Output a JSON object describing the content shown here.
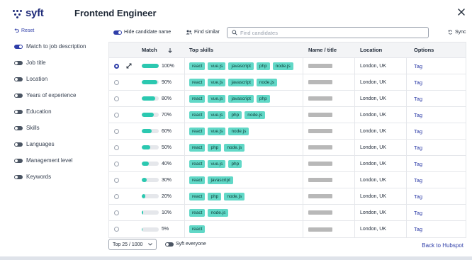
{
  "header": {
    "brand": "syft",
    "title": "Frontend Engineer",
    "close_icon": "close-icon",
    "brand_color": "#1e2a78"
  },
  "sidebar": {
    "reset_label": "Reset",
    "filters": [
      {
        "label": "Match to job description",
        "on": true
      },
      {
        "label": "Job title",
        "on": false
      },
      {
        "label": "Location",
        "on": false
      },
      {
        "label": "Years of experience",
        "on": false
      },
      {
        "label": "Education",
        "on": false
      },
      {
        "label": "Skills",
        "on": false
      },
      {
        "label": "Languages",
        "on": false
      },
      {
        "label": "Management level",
        "on": false
      },
      {
        "label": "Keywords",
        "on": false
      }
    ]
  },
  "toolbar": {
    "hide_name_label": "Hide candidate name",
    "hide_name_on": true,
    "find_similar_label": "Find similar",
    "search_placeholder": "Find candidates",
    "search_value": "",
    "sync_label": "Sync"
  },
  "table": {
    "headers": {
      "match": "Match",
      "skills": "Top skills",
      "name": "Name / title",
      "location": "Location",
      "options": "Options"
    },
    "rows": [
      {
        "selected": true,
        "expand": true,
        "match": 100,
        "match_label": "100%",
        "skills": [
          "react",
          "vue.js",
          "javascript",
          "php",
          "node.js"
        ],
        "location": "London, UK",
        "option": "Tag"
      },
      {
        "selected": false,
        "expand": false,
        "match": 90,
        "match_label": "90%",
        "skills": [
          "react",
          "vue.js",
          "javascript",
          "node.js"
        ],
        "location": "London, UK",
        "option": "Tag"
      },
      {
        "selected": false,
        "expand": false,
        "match": 80,
        "match_label": "80%",
        "skills": [
          "react",
          "vue.js",
          "javascript",
          "php"
        ],
        "location": "London, UK",
        "option": "Tag"
      },
      {
        "selected": false,
        "expand": false,
        "match": 70,
        "match_label": "70%",
        "skills": [
          "react",
          "vue.js",
          "php",
          "node.js"
        ],
        "location": "London, UK",
        "option": "Tag"
      },
      {
        "selected": false,
        "expand": false,
        "match": 60,
        "match_label": "60%",
        "skills": [
          "react",
          "vue.js",
          "node.js"
        ],
        "location": "London, UK",
        "option": "Tag"
      },
      {
        "selected": false,
        "expand": false,
        "match": 50,
        "match_label": "50%",
        "skills": [
          "react",
          "php",
          "node.js"
        ],
        "location": "London, UK",
        "option": "Tag"
      },
      {
        "selected": false,
        "expand": false,
        "match": 40,
        "match_label": "40%",
        "skills": [
          "react",
          "vue.js",
          "php"
        ],
        "location": "London, UK",
        "option": "Tag"
      },
      {
        "selected": false,
        "expand": false,
        "match": 30,
        "match_label": "30%",
        "skills": [
          "react",
          "javascript"
        ],
        "location": "London, UK",
        "option": "Tag"
      },
      {
        "selected": false,
        "expand": false,
        "match": 20,
        "match_label": "20%",
        "skills": [
          "react",
          "php",
          "node.js"
        ],
        "location": "London, UK",
        "option": "Tag"
      },
      {
        "selected": false,
        "expand": false,
        "match": 10,
        "match_label": "10%",
        "skills": [
          "react",
          "node.js"
        ],
        "location": "London, UK",
        "option": "Tag"
      },
      {
        "selected": false,
        "expand": false,
        "match": 5,
        "match_label": "5%",
        "skills": [
          "react"
        ],
        "location": "London, UK",
        "option": "Tag"
      }
    ]
  },
  "footer": {
    "top_select": "Top 25 / 1000",
    "syft_everyone_label": "Syft everyone",
    "syft_everyone_on": false,
    "back_label": "Back to Hubspot"
  },
  "colors": {
    "accent": "#2f3ea8",
    "match_bar": "#2bc8b0",
    "chip": "#61d8c7"
  }
}
